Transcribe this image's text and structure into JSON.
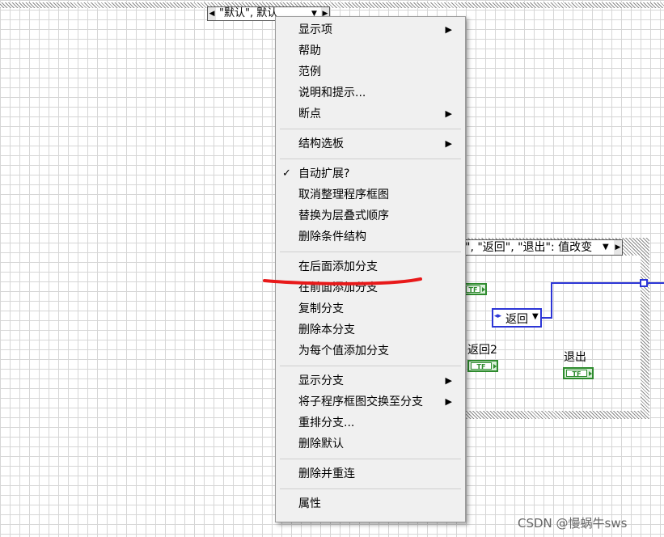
{
  "top_selector": {
    "text": "\"默认\", 默认"
  },
  "case_structure": {
    "selector_text": "\", \"返回\", \"退出\": 值改变",
    "terminals": {
      "return2_label": "返回2",
      "exit_label": "退出",
      "tf_text": "TF"
    },
    "enum_text": "返回"
  },
  "context_menu": {
    "groups": [
      [
        {
          "label": "显示项",
          "submenu": true
        },
        {
          "label": "帮助"
        },
        {
          "label": "范例"
        },
        {
          "label": "说明和提示..."
        },
        {
          "label": "断点",
          "submenu": true
        }
      ],
      [
        {
          "label": "结构选板",
          "submenu": true
        }
      ],
      [
        {
          "label": "自动扩展?",
          "checked": true
        },
        {
          "label": "取消整理程序框图"
        },
        {
          "label": "替换为层叠式顺序"
        },
        {
          "label": "删除条件结构"
        }
      ],
      [
        {
          "label": "在后面添加分支"
        },
        {
          "label": "在前面添加分支"
        },
        {
          "label": "复制分支"
        },
        {
          "label": "删除本分支"
        },
        {
          "label": "为每个值添加分支"
        }
      ],
      [
        {
          "label": "显示分支",
          "submenu": true
        },
        {
          "label": "将子程序框图交换至分支",
          "submenu": true
        },
        {
          "label": "重排分支..."
        },
        {
          "label": "删除默认"
        }
      ],
      [
        {
          "label": "删除并重连"
        }
      ],
      [
        {
          "label": "属性"
        }
      ]
    ],
    "check_glyph": "✓",
    "submenu_glyph": "▶"
  },
  "watermark": "CSDN @慢蜗牛sws",
  "colors": {
    "annotation_red": "#e8191a",
    "wire_blue": "#2d36d6",
    "boolean_green": "#2e8b2e"
  }
}
